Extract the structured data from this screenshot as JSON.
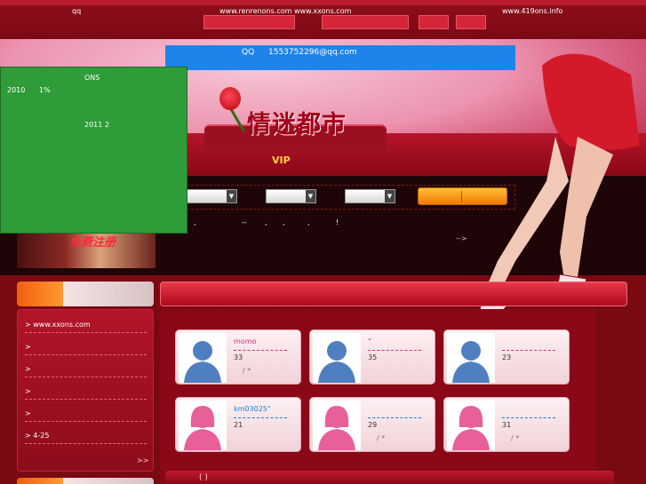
{
  "topbar": {
    "qq": "qq",
    "site1": "www.renrenons.com  www.xxons.com",
    "site2": "www.419ons.info"
  },
  "email_bar": {
    "qq_label": "QQ",
    "qq_email": "1553752296@qq.com"
  },
  "popup": {
    "title": "ONS",
    "year": "2010",
    "percent": "1%",
    "date": "2011 2"
  },
  "banner": {
    "logo": "情迷都市",
    "vip": "VIP"
  },
  "register_banner": {
    "text": "免费注册"
  },
  "notice": {
    "line": [
      ",",
      "--",
      ",",
      ",",
      ",",
      "!"
    ],
    "more": "-->"
  },
  "sidebar": {
    "items": [
      {
        "label": "> www.xxons.com"
      },
      {
        "label": ">"
      },
      {
        "label": ">"
      },
      {
        "label": ">"
      },
      {
        "label": ">"
      },
      {
        "label": "> 4-25"
      }
    ],
    "more": ">>"
  },
  "profiles": [
    {
      "name": "momo",
      "age": "33",
      "extra": "/ *",
      "gender": "male",
      "name_color": "#e0287a"
    },
    {
      "name": "\"",
      "age": "35",
      "extra": "",
      "gender": "male",
      "name_color": "#e0287a"
    },
    {
      "name": "",
      "age": "23",
      "extra": "",
      "gender": "male",
      "name_color": "#e0287a"
    },
    {
      "name": "km03025\"",
      "age": "21",
      "extra": "",
      "gender": "female",
      "name_color": "#1a7fd6"
    },
    {
      "name": "",
      "age": "29",
      "extra": "/ *",
      "gender": "female",
      "name_color": "#1a7fd6"
    },
    {
      "name": "",
      "age": "31",
      "extra": "/ *",
      "gender": "female",
      "name_color": "#1a7fd6"
    }
  ],
  "bottom": {
    "label": "(        )"
  },
  "colors": {
    "male_avatar": "#4f7fc0",
    "female_avatar": "#e8609a",
    "male_dash": "#e0287a",
    "female_dash": "#1a7fd6"
  }
}
